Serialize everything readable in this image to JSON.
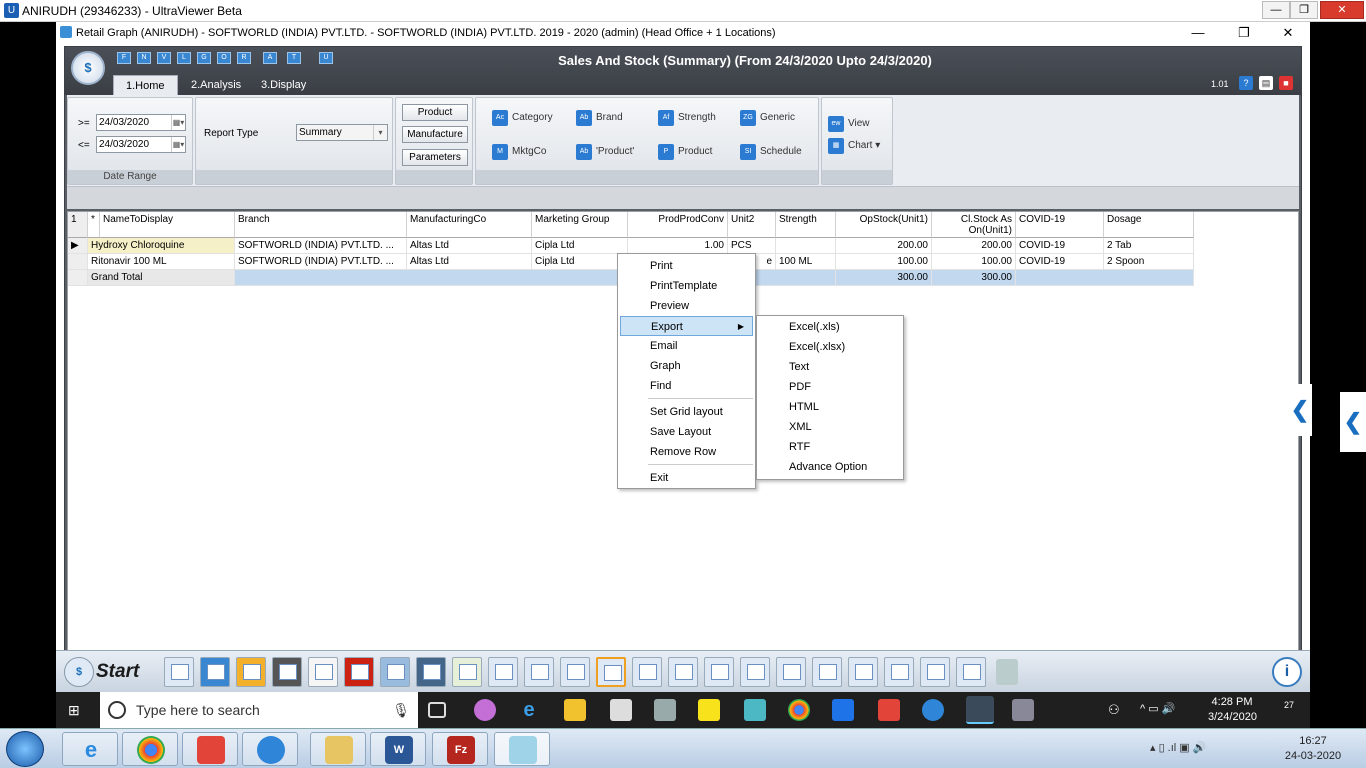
{
  "viewer": {
    "title": "ANIRUDH (29346233) - UltraViewer Beta"
  },
  "remote_window": {
    "title": "Retail Graph (ANIRUDH) - SOFTWORLD (INDIA) PVT.LTD. - SOFTWORLD (INDIA) PVT.LTD.  2019 - 2020 (admin) (Head Office + 1 Locations)"
  },
  "app": {
    "title": "Sales And Stock (Summary)  (From 24/3/2020 Upto 24/3/2020)",
    "version": "1.01",
    "logo_text": "$",
    "tabs": [
      "1.Home",
      "2.Analysis",
      "3.Display"
    ]
  },
  "ribbon": {
    "from_prefix": ">=",
    "to_prefix": "<=",
    "from_date": "24/03/2020",
    "to_date": "24/03/2020",
    "date_group_caption": "Date Range",
    "report_type_label": "Report Type",
    "report_type_value": "Summary",
    "buttons": [
      "Product",
      "Manufacture",
      "Parameters"
    ],
    "filters": [
      "Category",
      "Brand",
      "Strength",
      "Generic",
      "MktgCo",
      "'Product'",
      "Product",
      "Schedule"
    ],
    "view_label": "View",
    "chart_label": "Chart"
  },
  "grid": {
    "row_num_header": "1",
    "star_header": "*",
    "columns": [
      "NameToDisplay",
      "Branch",
      "ManufacturingCo",
      "Marketing Group",
      "ProdProdConv",
      "Unit2",
      "Strength",
      "OpStock(Unit1)",
      "Cl.Stock As On(Unit1)",
      "COVID-19",
      "Dosage"
    ],
    "rows": [
      [
        "Hydroxy Chloroquine",
        "SOFTWORLD (INDIA) PVT.LTD.   ...",
        "Altas Ltd",
        "Cipla Ltd",
        "1.00",
        "PCS",
        "",
        "200.00",
        "200.00",
        "COVID-19",
        "2 Tab"
      ],
      [
        "Ritonavir 100 ML",
        "SOFTWORLD (INDIA) PVT.LTD.   ...",
        "Altas Ltd",
        "Cipla Ltd",
        "",
        "e",
        "100 ML",
        "100.00",
        "100.00",
        "COVID-19",
        "2 Spoon"
      ]
    ],
    "total_row": [
      "Grand Total",
      "",
      "",
      "",
      "",
      "",
      "",
      "300.00",
      "300.00",
      "",
      ""
    ]
  },
  "context_menu": {
    "items": [
      "Print",
      "PrintTemplate",
      "Preview",
      "Export",
      "Email",
      "Graph",
      "Find",
      "Set Grid layout",
      "Save Layout",
      "Remove Row",
      "Exit"
    ],
    "selected": "Export"
  },
  "export_submenu": {
    "items": [
      "Excel(.xls)",
      "Excel(.xlsx)",
      "Text",
      "PDF",
      "HTML",
      "XML",
      "RTF",
      "Advance Option"
    ]
  },
  "app_bar": {
    "start_label": "Start"
  },
  "remote_taskbar": {
    "search_placeholder": "Type here to search",
    "time": "4:28 PM",
    "date": "3/24/2020",
    "notifications": "27"
  },
  "local_taskbar": {
    "time": "16:27",
    "date": "24-03-2020"
  }
}
